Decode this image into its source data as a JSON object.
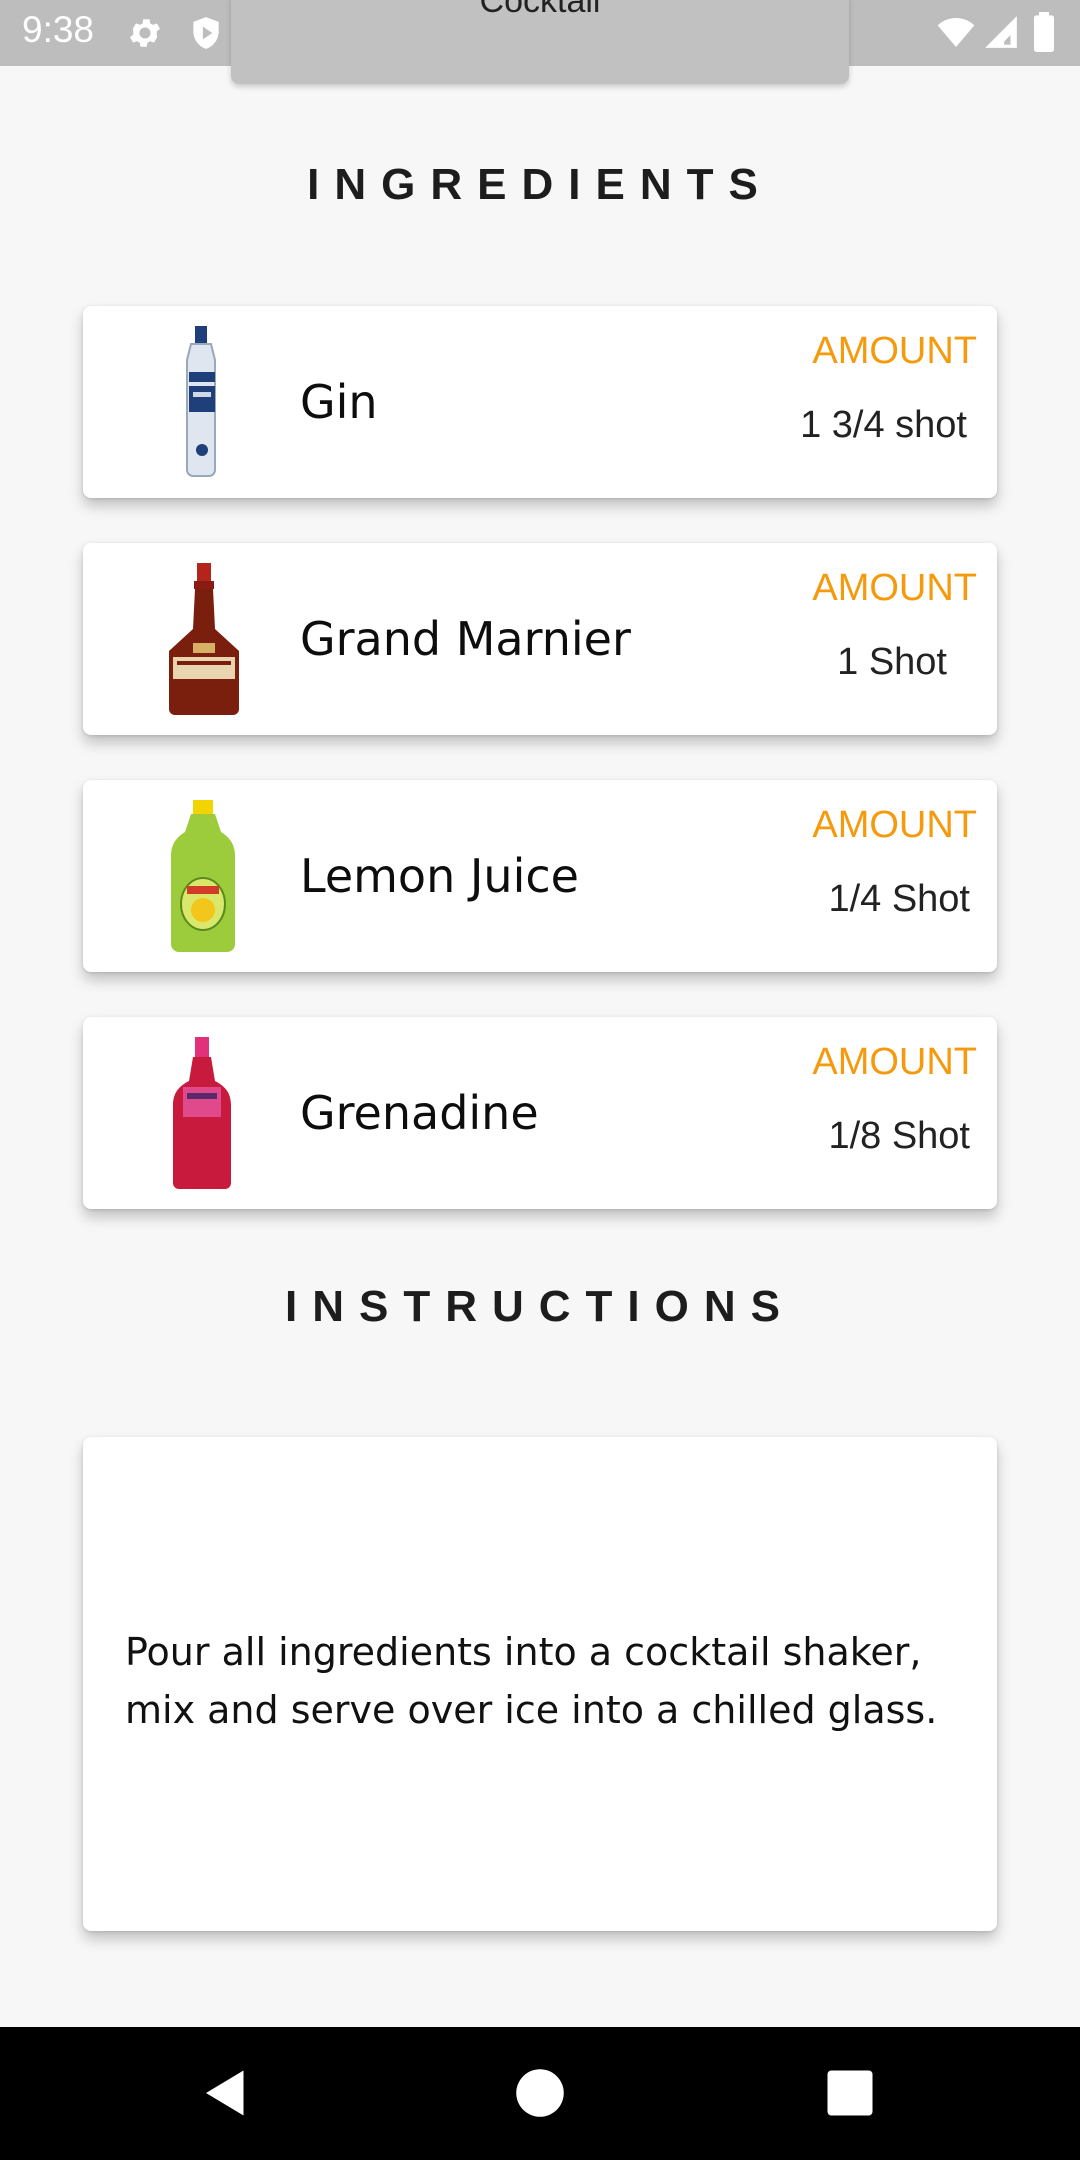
{
  "status_bar": {
    "time": "9:38",
    "left_icons": [
      "settings-icon",
      "shield-icon",
      "vpn-icon",
      "sd-card-icon"
    ],
    "right_icons": [
      "wifi-icon",
      "signal-icon",
      "battery-icon"
    ]
  },
  "popup": {
    "title": "Cocktail"
  },
  "ingredients_section": {
    "title": "INGREDIENTS",
    "amount_label": "AMOUNT",
    "items": [
      {
        "name": "Gin",
        "amount": "1 3/4 shot",
        "image": "gin-bottle"
      },
      {
        "name": "Grand Marnier",
        "amount": "1 Shot",
        "image": "grand-marnier-bottle"
      },
      {
        "name": "Lemon Juice",
        "amount": "1/4 Shot",
        "image": "lemon-juice-bottle"
      },
      {
        "name": "Grenadine",
        "amount": "1/8 Shot",
        "image": "grenadine-bottle"
      }
    ]
  },
  "instructions_section": {
    "title": "INSTRUCTIONS",
    "text": "Pour all ingredients into a cocktail shaker, mix and serve over ice into a chilled glass."
  },
  "nav_bar": {
    "buttons": [
      "back-icon",
      "home-icon",
      "recents-icon"
    ]
  },
  "colors": {
    "accent": "#f59a0c",
    "background": "#f7f7f7",
    "card": "#ffffff",
    "status_bar": "#bdbdbd"
  }
}
